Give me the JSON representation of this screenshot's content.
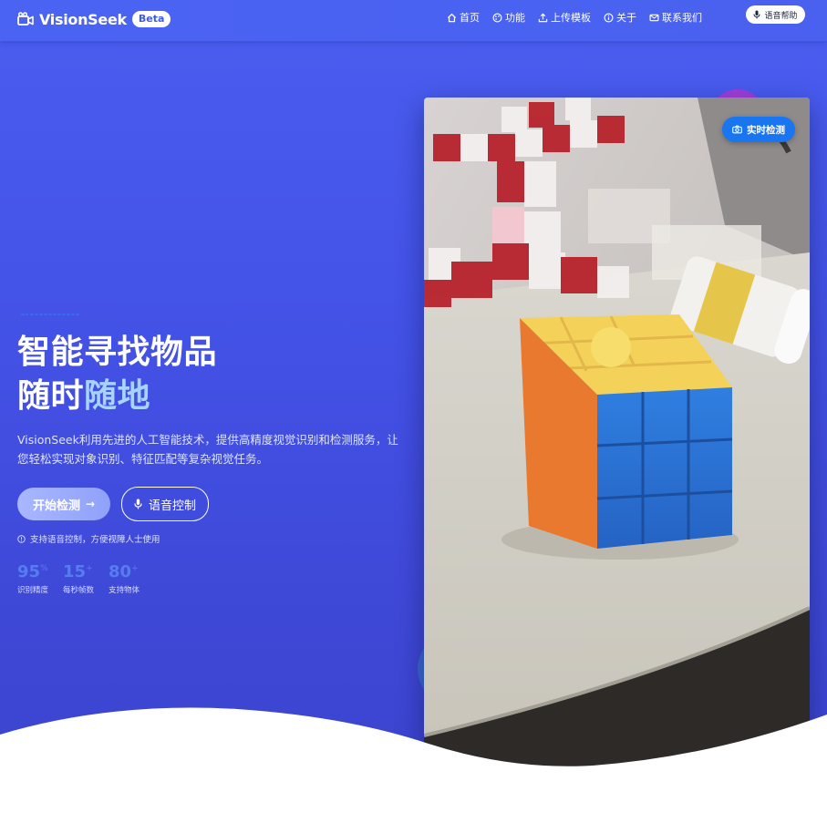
{
  "brand": {
    "name": "VisionSeek",
    "badge": "Beta"
  },
  "nav": {
    "items": [
      {
        "label": "首页",
        "icon": "home-icon"
      },
      {
        "label": "功能",
        "icon": "palette-icon"
      },
      {
        "label": "上传模板",
        "icon": "upload-icon"
      },
      {
        "label": "关于",
        "icon": "info-icon"
      },
      {
        "label": "联系我们",
        "icon": "mail-icon"
      }
    ],
    "voice_help": "语音帮助"
  },
  "hero": {
    "title_line1": "智能寻找物品",
    "title_line2_a": "随时",
    "title_line2_b": "随地",
    "description": "VisionSeek利用先进的人工智能技术，提供高精度视觉识别和检测服务，让您轻松实现对象识别、特征匹配等复杂视觉任务。",
    "primary_button": "开始检测",
    "secondary_button": "语音控制",
    "hint": "支持语音控制，方便视障人士使用",
    "stats": [
      {
        "value": "95",
        "unit": "%",
        "label": "识别精度"
      },
      {
        "value": "15",
        "unit": "+",
        "label": "每秒帧数"
      },
      {
        "value": "80",
        "unit": "+",
        "label": "支持物体"
      }
    ]
  },
  "image_panel": {
    "badge": "实时检测"
  },
  "colors": {
    "primary": "#4a5ef0",
    "accent": "#1976f0",
    "highlight": "#a6d4ff"
  }
}
